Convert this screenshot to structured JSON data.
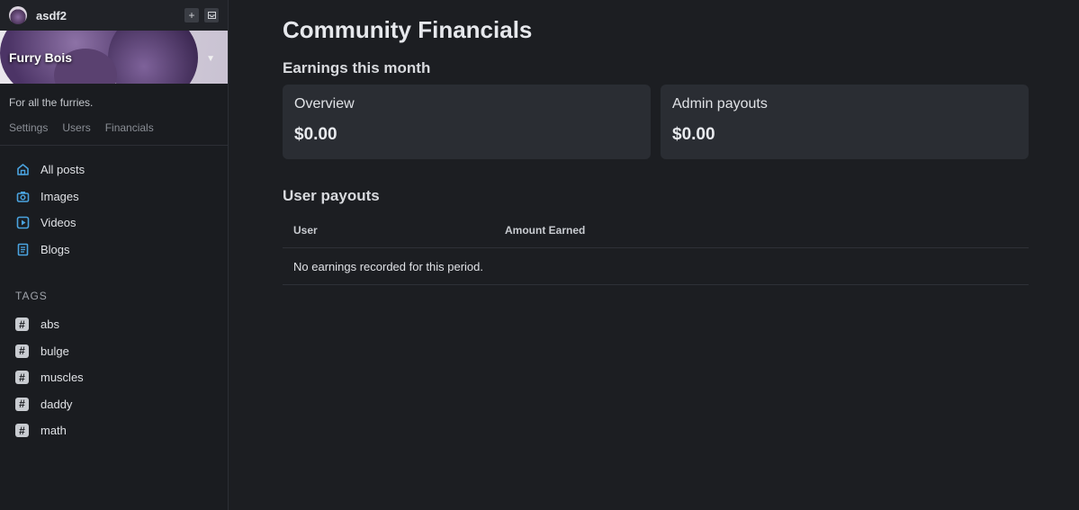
{
  "topbar": {
    "username": "asdf2",
    "icons": [
      "plus-icon",
      "inbox-icon"
    ]
  },
  "community": {
    "name": "Furry Bois",
    "description": "For all the furries.",
    "tabs": [
      "Settings",
      "Users",
      "Financials"
    ]
  },
  "nav": {
    "items": [
      {
        "label": "All posts",
        "icon": "home-icon"
      },
      {
        "label": "Images",
        "icon": "camera-icon"
      },
      {
        "label": "Videos",
        "icon": "play-icon"
      },
      {
        "label": "Blogs",
        "icon": "document-icon"
      }
    ]
  },
  "tags": {
    "heading": "TAGS",
    "items": [
      "abs",
      "bulge",
      "muscles",
      "daddy",
      "math"
    ]
  },
  "main": {
    "title": "Community Financials",
    "earnings_heading": "Earnings this month",
    "cards": [
      {
        "title": "Overview",
        "value": "$0.00"
      },
      {
        "title": "Admin payouts",
        "value": "$0.00"
      }
    ],
    "payouts_heading": "User payouts",
    "table": {
      "columns": [
        "User",
        "Amount Earned"
      ],
      "empty_message": "No earnings recorded for this period."
    }
  },
  "colors": {
    "background": "#1c1e22",
    "sidebar": "#1a1c20",
    "card": "#2a2d33",
    "nav_icon": "#4aa3df"
  }
}
